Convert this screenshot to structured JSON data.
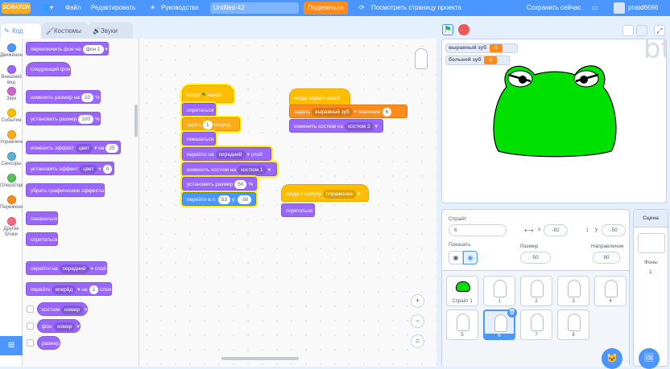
{
  "topbar": {
    "logo": "SCRATCH",
    "file": "Файл",
    "edit": "Редактировать",
    "tutorials": "Руководства",
    "project_title": "Untitled-42",
    "share": "Поделиться",
    "see_project": "Посмотреть страницу проекта",
    "save_now": "Сохранить сейчас",
    "username": "pnaid6666"
  },
  "tabs": {
    "code": "Код",
    "costumes": "Костюмы",
    "sounds": "Звуки"
  },
  "categories": [
    {
      "label": "Движение",
      "color": "#4c97ff"
    },
    {
      "label": "Внешний вид",
      "color": "#9966ff"
    },
    {
      "label": "Звук",
      "color": "#cf63cf"
    },
    {
      "label": "События",
      "color": "#ffbf00"
    },
    {
      "label": "Управление",
      "color": "#ffab19"
    },
    {
      "label": "Сенсоры",
      "color": "#5cb1d6"
    },
    {
      "label": "Операторы",
      "color": "#59c059"
    },
    {
      "label": "Переменные",
      "color": "#ff8c1a"
    },
    {
      "label": "Другие блоки",
      "color": "#ff6680"
    }
  ],
  "palette": {
    "switch_backdrop": "переключить фон на",
    "switch_backdrop_val": "фон 1",
    "next_backdrop": "следующий фон",
    "set_size": "изменить размер на",
    "set_size_val": "10",
    "pct": "%",
    "set_size_to": "установить размер",
    "set_size_to_val": "100",
    "change_effect": "изменить эффект",
    "effect_color": "цвет",
    "by": "на",
    "change_effect_val": "25",
    "set_effect": "установить эффект",
    "set_effect_val": "0",
    "clear_effects": "убрать графические эффекты",
    "show": "показаться",
    "hide": "спрятаться",
    "go_to_layer": "перейти на",
    "layer_front": "передний",
    "layer": "слой",
    "go_layer": "перейти",
    "forward": "вперёд",
    "go_layer_val": "1",
    "layers": "слоя",
    "costume": "костюм",
    "costume_number": "номер",
    "backdrop": "фон",
    "backdrop_number": "номер",
    "size": "размер"
  },
  "script1": {
    "when_flag": "когда",
    "clicked": "нажат",
    "hide": "спрятаться",
    "wait": "ждать",
    "wait_val": "1",
    "seconds": "секунд",
    "show": "показаться",
    "go_to": "перейти на",
    "front": "передний",
    "layer": "слой",
    "switch_costume": "изменить костюм на",
    "costume_val": "костюм 1",
    "set_size": "установить размер",
    "size_val": "50",
    "pct": "%",
    "goto_xy": "перейти в x:",
    "x_val": "53",
    "y_label": "y:",
    "y_val": "-50"
  },
  "script2": {
    "when_clone": "когда спрайт нажат",
    "set_var": "задать",
    "var_name": "выравный зуб",
    "value": "значение",
    "value_val": "6",
    "switch_costume": "изменить костюм на",
    "costume_val": "костюм 2"
  },
  "script3": {
    "when_receive": "когда я получу",
    "message": "поражение",
    "hide": "спрятаться"
  },
  "stage": {
    "monitors": [
      {
        "label": "выравный зуб",
        "value": "0"
      },
      {
        "label": "больной зуб",
        "value": "4"
      }
    ],
    "watermark": "bt"
  },
  "sprite_panel": {
    "sprite_label": "Спрайт",
    "sprite_name": "6",
    "x_label": "x",
    "x_val": "-82",
    "y_label": "y",
    "y_val": "-50",
    "show_label": "Показать",
    "size_label": "Размер",
    "size_val": "50",
    "direction_label": "Направление",
    "direction_val": "90",
    "sprites": [
      {
        "name": "Спрайт 1"
      },
      {
        "name": "1"
      },
      {
        "name": "2"
      },
      {
        "name": "3"
      },
      {
        "name": "4"
      },
      {
        "name": "5"
      },
      {
        "name": "6"
      },
      {
        "name": "7"
      },
      {
        "name": "8"
      }
    ]
  },
  "stage_panel": {
    "title": "Сцена",
    "backdrops_label": "Фоны",
    "backdrops_count": "1"
  }
}
